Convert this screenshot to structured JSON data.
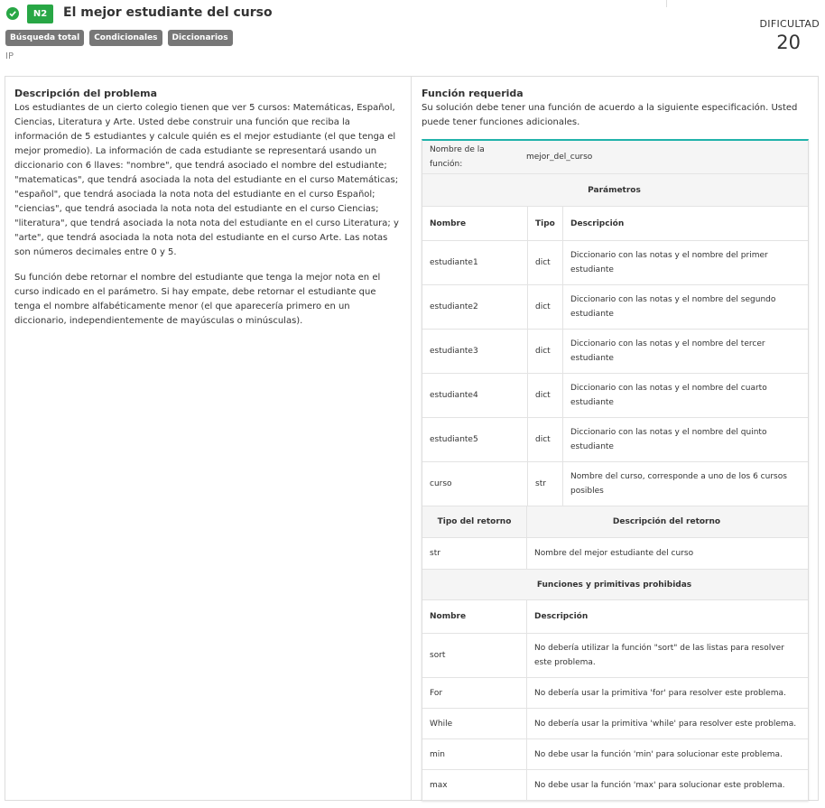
{
  "header": {
    "level_badge": "N2",
    "title": "El mejor estudiante del curso",
    "tags": [
      "Búsqueda total",
      "Condicionales",
      "Diccionarios"
    ],
    "author": "IP",
    "difficulty_label": "DIFICULTAD",
    "difficulty_value": "20",
    "colors": {
      "success": "#28a745",
      "tag": "#777777",
      "accent": "#20b2aa"
    }
  },
  "description": {
    "title": "Descripción del problema",
    "p1": "Los estudiantes de un cierto colegio tienen que ver 5 cursos: Matemáticas, Español, Ciencias, Literatura y Arte. Usted debe construir una función que reciba la información de 5 estudiantes y calcule quién es el mejor estudiante (el que tenga el mejor promedio). La información de cada estudiante se representará usando un diccionario con 6 llaves: \"nombre\", que tendrá asociado el nombre del estudiante; \"matematicas\", que tendrá asociada la nota del estudiante en el curso Matemáticas; \"español\", que tendrá asociada la nota nota del estudiante en el curso Español; \"ciencias\", que tendrá asociada la nota nota del estudiante en el curso Ciencias; \"literatura\", que tendrá asociada la nota nota del estudiante en el curso Literatura; y \"arte\", que tendrá asociada la nota nota del estudiante en el curso Arte. Las notas son números decimales entre 0 y 5.",
    "p2": "Su función debe retornar el nombre del estudiante que tenga la mejor nota en el curso indicado en el parámetro. Si hay empate, debe retornar el estudiante que tenga el nombre alfabéticamente menor (el que aparecería primero en un diccionario, independientemente de mayúsculas o minúsculas)."
  },
  "function": {
    "title": "Función requerida",
    "intro": "Su solución debe tener una función de acuerdo a la siguiente especificación. Usted puede tener funciones adicionales.",
    "name_label": "Nombre de la función:",
    "name_value": "mejor_del_curso",
    "params_title": "Parámetros",
    "params_headers": [
      "Nombre",
      "Tipo",
      "Descripción"
    ],
    "params": [
      {
        "name": "estudiante1",
        "type": "dict",
        "desc": "Diccionario con las notas y el nombre del primer estudiante"
      },
      {
        "name": "estudiante2",
        "type": "dict",
        "desc": "Diccionario con las notas y el nombre del segundo estudiante"
      },
      {
        "name": "estudiante3",
        "type": "dict",
        "desc": "Diccionario con las notas y el nombre del tercer estudiante"
      },
      {
        "name": "estudiante4",
        "type": "dict",
        "desc": "Diccionario con las notas y el nombre del cuarto estudiante"
      },
      {
        "name": "estudiante5",
        "type": "dict",
        "desc": "Diccionario con las notas y el nombre del quinto estudiante"
      },
      {
        "name": "curso",
        "type": "str",
        "desc": "Nombre del curso, corresponde a uno de los 6 cursos posibles"
      }
    ],
    "return_type_label": "Tipo del retorno",
    "return_desc_label": "Descripción del retorno",
    "return_type": "str",
    "return_desc": "Nombre del mejor estudiante del curso",
    "forbidden_title": "Funciones y primitivas prohibidas",
    "forbidden_headers": [
      "Nombre",
      "Descripción"
    ],
    "forbidden": [
      {
        "name": "sort",
        "desc": "No debería utilizar la función \"sort\" de las listas para resolver este problema."
      },
      {
        "name": "For",
        "desc": "No debería usar la primitiva 'for' para resolver este problema."
      },
      {
        "name": "While",
        "desc": "No debería usar la primitiva 'while' para resolver este problema."
      },
      {
        "name": "min",
        "desc": "No debe usar la función 'min' para solucionar este problema."
      },
      {
        "name": "max",
        "desc": "No debe usar la función 'max' para solucionar este problema."
      }
    ]
  }
}
